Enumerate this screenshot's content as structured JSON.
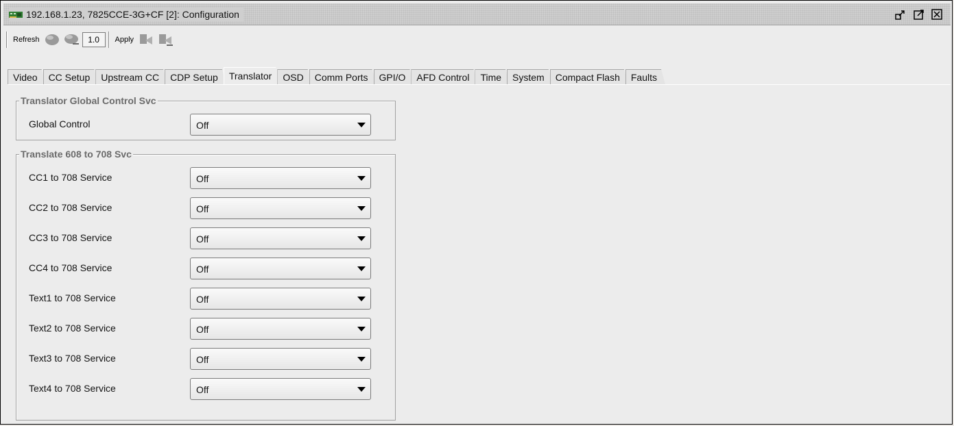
{
  "window": {
    "title": "192.168.1.23, 7825CCE-3G+CF  [2]: Configuration",
    "controls": [
      "undock-icon",
      "maximize-icon",
      "close-icon"
    ]
  },
  "toolbar": {
    "refresh_label": "Refresh",
    "version_value": "1.0",
    "apply_label": "Apply"
  },
  "tabs": [
    {
      "label": "Video"
    },
    {
      "label": "CC Setup"
    },
    {
      "label": "Upstream CC"
    },
    {
      "label": "CDP Setup"
    },
    {
      "label": "Translator",
      "active": true
    },
    {
      "label": "OSD"
    },
    {
      "label": "Comm Ports"
    },
    {
      "label": "GPI/O"
    },
    {
      "label": "AFD Control"
    },
    {
      "label": "Time"
    },
    {
      "label": "System"
    },
    {
      "label": "Compact Flash"
    },
    {
      "label": "Faults"
    }
  ],
  "global_group": {
    "title": "Translator Global Control Svc",
    "rows": [
      {
        "label": "Global Control",
        "value": "Off"
      }
    ]
  },
  "translate_group": {
    "title": "Translate 608 to 708 Svc",
    "rows": [
      {
        "label": "CC1 to 708 Service",
        "value": "Off"
      },
      {
        "label": "CC2 to 708 Service",
        "value": "Off"
      },
      {
        "label": "CC3 to 708 Service",
        "value": "Off"
      },
      {
        "label": "CC4 to 708 Service",
        "value": "Off"
      },
      {
        "label": "Text1 to 708 Service",
        "value": "Off"
      },
      {
        "label": "Text2 to 708 Service",
        "value": "Off"
      },
      {
        "label": "Text3 to 708 Service",
        "value": "Off"
      },
      {
        "label": "Text4 to 708 Service",
        "value": "Off"
      }
    ]
  }
}
